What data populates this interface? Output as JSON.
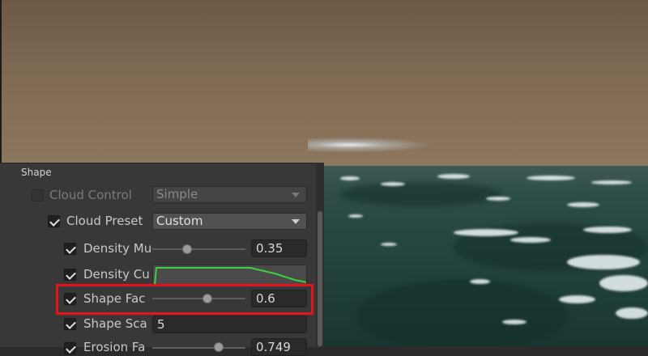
{
  "inspector": {
    "section_title": "Shape",
    "rows": [
      {
        "label": "Cloud Control",
        "checked": false,
        "enabled": false,
        "control": "dropdown",
        "value": "Simple"
      },
      {
        "label": "Cloud Preset",
        "checked": true,
        "enabled": true,
        "control": "dropdown",
        "value": "Custom"
      },
      {
        "label": "Density Mu",
        "checked": true,
        "enabled": true,
        "control": "slider",
        "value": "0.35",
        "slider_fraction": 0.35
      },
      {
        "label": "Density Cu",
        "checked": true,
        "enabled": true,
        "control": "curve"
      },
      {
        "label": "Shape Fac",
        "checked": true,
        "enabled": true,
        "control": "slider",
        "value": "0.6",
        "slider_fraction": 0.6
      },
      {
        "label": "Shape Sca",
        "checked": true,
        "enabled": true,
        "control": "number",
        "value": "5"
      },
      {
        "label": "Erosion Fa",
        "checked": true,
        "enabled": true,
        "control": "slider",
        "value": "0.749",
        "slider_fraction": 0.749
      }
    ]
  },
  "colors": {
    "highlight": "#e8131a",
    "curve": "#3ecf3e",
    "panel": "#383838"
  }
}
